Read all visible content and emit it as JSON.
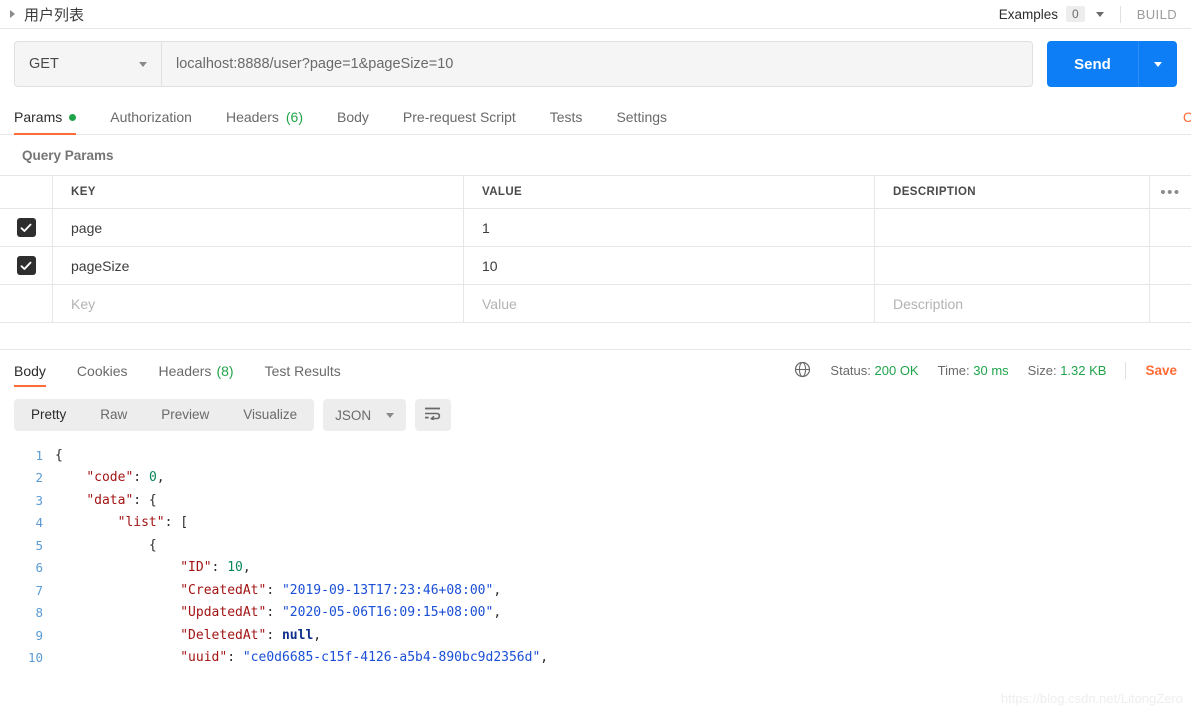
{
  "topbar": {
    "request_title": "用户列表",
    "examples_label": "Examples",
    "examples_count": "0",
    "build_label": "BUILD"
  },
  "urlbar": {
    "method": "GET",
    "url": "localhost:8888/user?page=1&pageSize=10",
    "send_label": "Send"
  },
  "request_tabs": [
    {
      "label": "Params",
      "dot": true,
      "active": true
    },
    {
      "label": "Authorization",
      "active": false
    },
    {
      "label": "Headers",
      "count": "(6)",
      "active": false
    },
    {
      "label": "Body",
      "active": false
    },
    {
      "label": "Pre-request Script",
      "active": false
    },
    {
      "label": "Tests",
      "active": false
    },
    {
      "label": "Settings",
      "active": false
    }
  ],
  "cookies_link": "C",
  "query_params": {
    "section_title": "Query Params",
    "columns": [
      "KEY",
      "VALUE",
      "DESCRIPTION"
    ],
    "more_icon": "•••",
    "rows": [
      {
        "checked": true,
        "key": "page",
        "value": "1",
        "description": ""
      },
      {
        "checked": true,
        "key": "pageSize",
        "value": "10",
        "description": ""
      }
    ],
    "placeholder_row": {
      "key": "Key",
      "value": "Value",
      "description": "Description"
    }
  },
  "response": {
    "tabs": [
      {
        "label": "Body",
        "active": true
      },
      {
        "label": "Cookies",
        "active": false
      },
      {
        "label": "Headers",
        "count": "(8)",
        "active": false
      },
      {
        "label": "Test Results",
        "active": false
      }
    ],
    "status_label": "Status:",
    "status_value": "200 OK",
    "time_label": "Time:",
    "time_value": "30 ms",
    "size_label": "Size:",
    "size_value": "1.32 KB",
    "save_label": "Save",
    "globe_icon": "globe-icon"
  },
  "body_toolbar": {
    "views": [
      {
        "label": "Pretty",
        "active": true
      },
      {
        "label": "Raw",
        "active": false
      },
      {
        "label": "Preview",
        "active": false
      },
      {
        "label": "Visualize",
        "active": false
      }
    ],
    "format": "JSON",
    "wrap_icon": "wrap-lines-icon"
  },
  "code_lines": [
    {
      "no": "1",
      "indent": 0,
      "tokens": [
        {
          "t": "p",
          "v": "{"
        }
      ]
    },
    {
      "no": "2",
      "indent": 1,
      "tokens": [
        {
          "t": "k",
          "v": "\"code\""
        },
        {
          "t": "p",
          "v": ": "
        },
        {
          "t": "n",
          "v": "0"
        },
        {
          "t": "p",
          "v": ","
        }
      ]
    },
    {
      "no": "3",
      "indent": 1,
      "tokens": [
        {
          "t": "k",
          "v": "\"data\""
        },
        {
          "t": "p",
          "v": ": {"
        }
      ]
    },
    {
      "no": "4",
      "indent": 2,
      "tokens": [
        {
          "t": "k",
          "v": "\"list\""
        },
        {
          "t": "p",
          "v": ": ["
        }
      ]
    },
    {
      "no": "5",
      "indent": 3,
      "tokens": [
        {
          "t": "p",
          "v": "{"
        }
      ]
    },
    {
      "no": "6",
      "indent": 4,
      "tokens": [
        {
          "t": "k",
          "v": "\"ID\""
        },
        {
          "t": "p",
          "v": ": "
        },
        {
          "t": "n",
          "v": "10"
        },
        {
          "t": "p",
          "v": ","
        }
      ]
    },
    {
      "no": "7",
      "indent": 4,
      "tokens": [
        {
          "t": "k",
          "v": "\"CreatedAt\""
        },
        {
          "t": "p",
          "v": ": "
        },
        {
          "t": "s",
          "v": "\"2019-09-13T17:23:46+08:00\""
        },
        {
          "t": "p",
          "v": ","
        }
      ]
    },
    {
      "no": "8",
      "indent": 4,
      "tokens": [
        {
          "t": "k",
          "v": "\"UpdatedAt\""
        },
        {
          "t": "p",
          "v": ": "
        },
        {
          "t": "s",
          "v": "\"2020-05-06T16:09:15+08:00\""
        },
        {
          "t": "p",
          "v": ","
        }
      ]
    },
    {
      "no": "9",
      "indent": 4,
      "tokens": [
        {
          "t": "k",
          "v": "\"DeletedAt\""
        },
        {
          "t": "p",
          "v": ": "
        },
        {
          "t": "nl",
          "v": "null"
        },
        {
          "t": "p",
          "v": ","
        }
      ]
    },
    {
      "no": "10",
      "indent": 4,
      "tokens": [
        {
          "t": "k",
          "v": "\"uuid\""
        },
        {
          "t": "p",
          "v": ": "
        },
        {
          "t": "s",
          "v": "\"ce0d6685-c15f-4126-a5b4-890bc9d2356d\""
        },
        {
          "t": "p",
          "v": ","
        }
      ]
    }
  ],
  "watermark": "https://blog.csdn.net/LitongZero",
  "colors": {
    "accent_orange": "#ff6c37",
    "send_blue": "#0d7ef6",
    "status_green": "#20a44b"
  }
}
